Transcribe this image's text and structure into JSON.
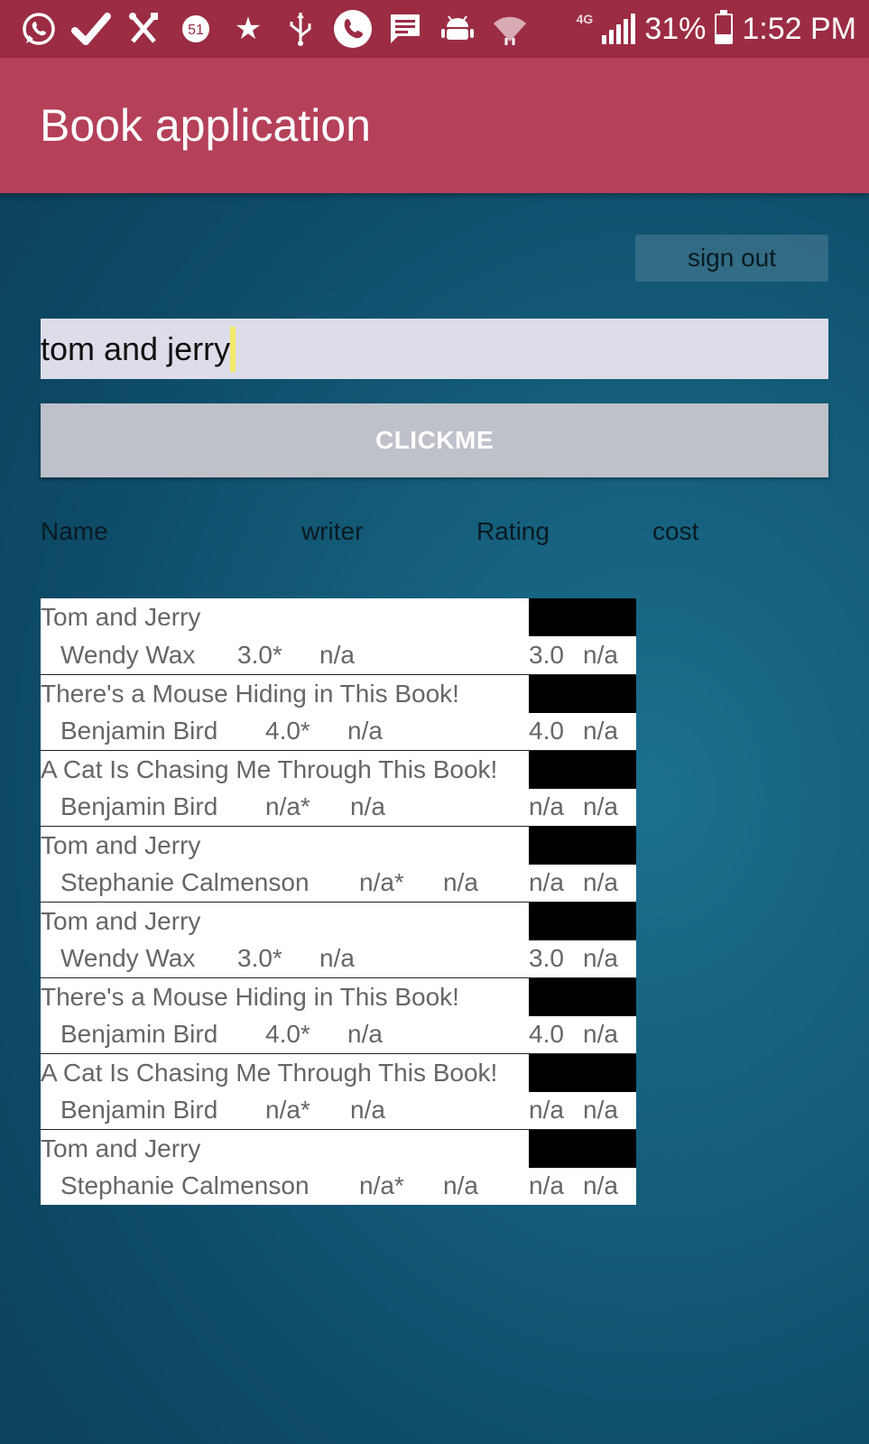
{
  "status_bar": {
    "icons": [
      "whatsapp-icon",
      "check-icon",
      "tools-icon",
      "badge-51-icon",
      "star-icon",
      "usb-icon",
      "phone-icon",
      "message-icon",
      "android-icon",
      "wifi-icon"
    ],
    "badge_number": "51",
    "network": "4G",
    "battery": "31%",
    "time": "1:52 PM"
  },
  "app_bar": {
    "title": "Book application"
  },
  "sign_out_label": "sign out",
  "search": {
    "value": "tom and jerry"
  },
  "click_button_label": "CLICKME",
  "columns": [
    "Name",
    "writer",
    "Rating",
    "cost"
  ],
  "results": [
    {
      "title": "Tom and Jerry",
      "author": "Wendy Wax",
      "rating": "3.0*",
      "cost": "n/a",
      "rating2": "3.0",
      "cost2": "n/a"
    },
    {
      "title": "There's a Mouse Hiding in This Book!",
      "author": "Benjamin Bird",
      "rating": "4.0*",
      "cost": "n/a",
      "rating2": "4.0",
      "cost2": "n/a"
    },
    {
      "title": "A Cat Is Chasing Me Through This Book!",
      "author": "Benjamin Bird",
      "rating": "n/a*",
      "cost": "n/a",
      "rating2": "n/a",
      "cost2": "n/a"
    },
    {
      "title": "Tom and Jerry",
      "author": "Stephanie Calmenson",
      "rating": "n/a*",
      "cost": "n/a",
      "rating2": "n/a",
      "cost2": "n/a"
    },
    {
      "title": "Tom and Jerry",
      "author": "Wendy Wax",
      "rating": "3.0*",
      "cost": "n/a",
      "rating2": "3.0",
      "cost2": "n/a"
    },
    {
      "title": "There's a Mouse Hiding in This Book!",
      "author": "Benjamin Bird",
      "rating": "4.0*",
      "cost": "n/a",
      "rating2": "4.0",
      "cost2": "n/a"
    },
    {
      "title": "A Cat Is Chasing Me Through This Book!",
      "author": "Benjamin Bird",
      "rating": "n/a*",
      "cost": "n/a",
      "rating2": "n/a",
      "cost2": "n/a"
    },
    {
      "title": "Tom and Jerry",
      "author": "Stephanie Calmenson",
      "rating": "n/a*",
      "cost": "n/a",
      "rating2": "n/a",
      "cost2": "n/a"
    }
  ],
  "colors": {
    "status_bar": "#9b2c44",
    "app_bar": "#b5405a",
    "cursor": "#f4e866"
  }
}
